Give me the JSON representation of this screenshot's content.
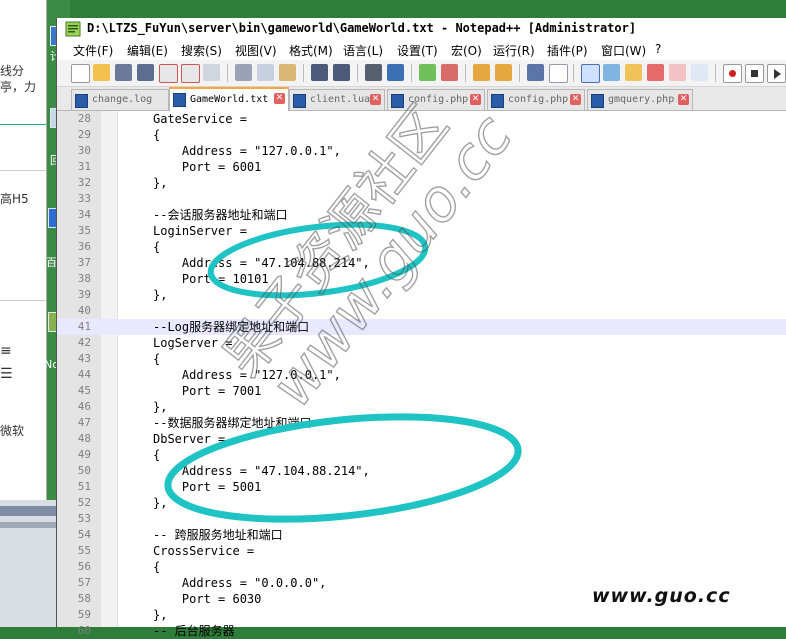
{
  "window": {
    "title": "D:\\LTZS_FuYun\\server\\bin\\gameworld\\GameWorld.txt - Notepad++ [Administrator]"
  },
  "menu": [
    "文件(F)",
    "编辑(E)",
    "搜索(S)",
    "视图(V)",
    "格式(M)",
    "语言(L)",
    "设置(T)",
    "宏(O)",
    "运行(R)",
    "插件(P)",
    "窗口(W)",
    "?"
  ],
  "tabs": [
    {
      "label": "change.log",
      "active": false
    },
    {
      "label": "GameWorld.txt",
      "active": true
    },
    {
      "label": "client.lua",
      "active": false
    },
    {
      "label": "config.php",
      "active": false
    },
    {
      "label": "config.php",
      "active": false
    },
    {
      "label": "gmquery.php",
      "active": false
    }
  ],
  "editor": {
    "current_line": 41,
    "lines": [
      {
        "n": "28",
        "text": "GateService ="
      },
      {
        "n": "29",
        "text": "{"
      },
      {
        "n": "30",
        "text": "    Address = \"127.0.0.1\","
      },
      {
        "n": "31",
        "text": "    Port = 6001"
      },
      {
        "n": "32",
        "text": "},"
      },
      {
        "n": "33",
        "text": ""
      },
      {
        "n": "34",
        "text": "--会话服务器地址和端口"
      },
      {
        "n": "35",
        "text": "LoginServer ="
      },
      {
        "n": "36",
        "text": "{"
      },
      {
        "n": "37",
        "text": "    Address = \"47.104.88.214\","
      },
      {
        "n": "38",
        "text": "    Port = 10101"
      },
      {
        "n": "39",
        "text": "},"
      },
      {
        "n": "40",
        "text": ""
      },
      {
        "n": "41",
        "text": "--Log服务器绑定地址和端口"
      },
      {
        "n": "42",
        "text": "LogServer ="
      },
      {
        "n": "43",
        "text": "{"
      },
      {
        "n": "44",
        "text": "    Address = \"127.0.0.1\","
      },
      {
        "n": "45",
        "text": "    Port = 7001"
      },
      {
        "n": "46",
        "text": "},"
      },
      {
        "n": "47",
        "text": "--数据服务器绑定地址和端口"
      },
      {
        "n": "48",
        "text": "DbServer ="
      },
      {
        "n": "49",
        "text": "{"
      },
      {
        "n": "50",
        "text": "    Address = \"47.104.88.214\","
      },
      {
        "n": "51",
        "text": "    Port = 5001"
      },
      {
        "n": "52",
        "text": "},"
      },
      {
        "n": "53",
        "text": ""
      },
      {
        "n": "54",
        "text": "-- 跨服服务地址和端口"
      },
      {
        "n": "55",
        "text": "CrossService ="
      },
      {
        "n": "56",
        "text": "{"
      },
      {
        "n": "57",
        "text": "    Address = \"0.0.0.0\","
      },
      {
        "n": "58",
        "text": "    Port = 6030"
      },
      {
        "n": "59",
        "text": "},"
      },
      {
        "n": "60",
        "text": "-- 后台服务器"
      }
    ]
  },
  "desktop": {
    "left_texts": [
      "线分",
      "亭，力",
      "高H5",
      "微软"
    ],
    "icon_labels": [
      "计",
      "回",
      "百月",
      "Not"
    ]
  },
  "watermark": {
    "stamp": "果子资源社区",
    "diagonal_url": "www.guo.cc",
    "corner_url": "www.guo.cc"
  },
  "colors": {
    "annotation_circle": "#1fc3c3",
    "current_line": "#e8e8ff",
    "active_tab_accent": "#f4a640"
  }
}
